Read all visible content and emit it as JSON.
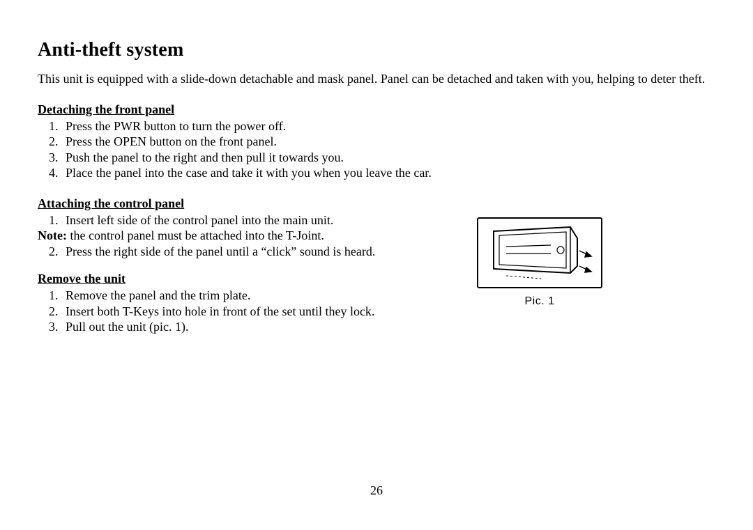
{
  "title": "Anti-theft system",
  "intro": "This unit is equipped with a slide-down detachable and mask panel. Panel can be detached and taken with you, helping to deter theft.",
  "sections": {
    "detach": {
      "heading": "Detaching the front panel",
      "steps": [
        "Press the PWR button to turn the power off.",
        "Press the OPEN button on the front panel.",
        "Push the panel to the right and then pull it towards you.",
        "Place the panel into the case and take it with you when you leave the car."
      ]
    },
    "attach": {
      "heading": "Attaching the control panel",
      "step1": "Insert left side of the control panel into the main unit.",
      "note_label": "Note:",
      "note_text": " the control panel must be attached into the T-Joint.",
      "step2": "Press the right side of the panel until a “click” sound is heard."
    },
    "remove": {
      "heading": "Remove the unit",
      "steps": [
        "Remove the panel and the trim plate.",
        "Insert both T-Keys into hole in front of the set until they lock.",
        "Pull out the unit (pic. 1)."
      ]
    }
  },
  "figure_caption": "Pic. 1",
  "page_number": "26"
}
